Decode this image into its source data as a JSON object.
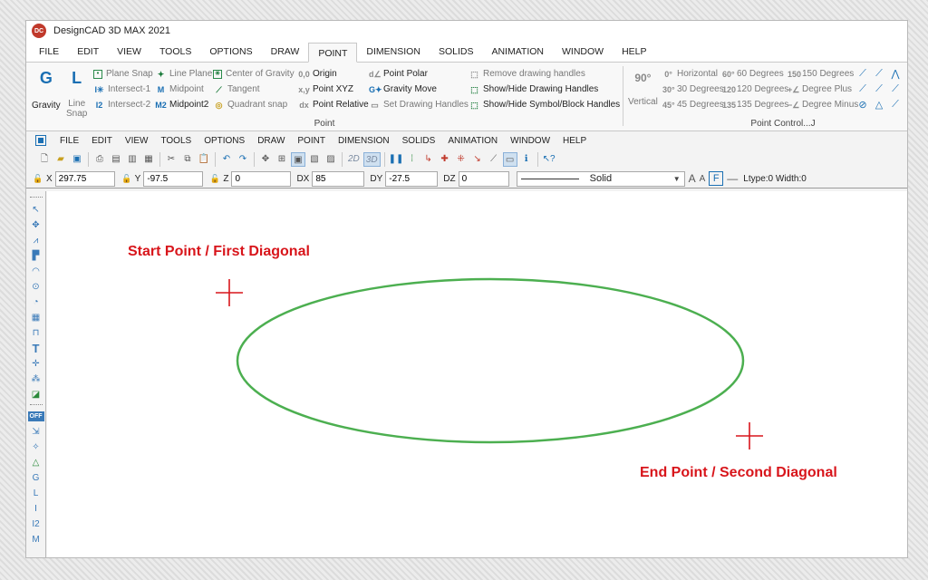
{
  "window": {
    "title": "DesignCAD 3D MAX 2021",
    "app_icon_text": "DC"
  },
  "ribbon_tabs": [
    "FILE",
    "EDIT",
    "VIEW",
    "TOOLS",
    "OPTIONS",
    "DRAW",
    "POINT",
    "DIMENSION",
    "SOLIDS",
    "ANIMATION",
    "WINDOW",
    "HELP"
  ],
  "active_tab": "POINT",
  "ribbon": {
    "gravity": {
      "label": "Gravity",
      "icon_text": "G"
    },
    "line_snap": {
      "label1": "Line",
      "label2": "Snap",
      "icon_text": "L"
    },
    "col1": [
      "Plane Snap",
      "Intersect-1",
      "Intersect-2"
    ],
    "col2": [
      "Line Plane",
      "Midpoint",
      "Midpoint2"
    ],
    "col3": [
      "Center of Gravity",
      "Tangent",
      "Quadrant snap"
    ],
    "col4": [
      "Origin",
      "Point XYZ",
      "Point Relative"
    ],
    "col5": [
      "Point Polar",
      "Gravity Move",
      "Set Drawing Handles"
    ],
    "col6": [
      "Remove drawing handles",
      "Show/Hide Drawing Handles",
      "Show/Hide Symbol/Block Handles"
    ],
    "point_group_label": "Point",
    "vertical": {
      "label": "Vertical",
      "icon_text": "90°"
    },
    "col7": [
      "Horizontal",
      "30 Degrees",
      "45 Degrees"
    ],
    "col8": [
      "60 Degrees",
      "120 Degrees",
      "135 Degrees"
    ],
    "col9": [
      "150 Degrees",
      "Degree Plus",
      "Degree Minus"
    ],
    "point_control_label": "Point Control...J"
  },
  "classic_menu": [
    "FILE",
    "EDIT",
    "VIEW",
    "TOOLS",
    "OPTIONS",
    "DRAW",
    "POINT",
    "DIMENSION",
    "SOLIDS",
    "ANIMATION",
    "WINDOW",
    "HELP"
  ],
  "toolbar": {
    "btn_2d": "2D",
    "btn_3d": "3D"
  },
  "coords": {
    "x_label": "X",
    "x": "297.75",
    "y_label": "Y",
    "y": "-97.5",
    "z_label": "Z",
    "z": "0",
    "dx_label": "DX",
    "dx": "85",
    "dy_label": "DY",
    "dy": "-27.5",
    "dz_label": "DZ",
    "dz": "0"
  },
  "linetype": {
    "name": "Solid",
    "info": "Ltype:0  Width:0"
  },
  "toolbox": {
    "off_label": "OFF"
  },
  "canvas": {
    "annotation_start": "Start Point / First Diagonal",
    "annotation_end": "End Point / Second Diagonal",
    "ellipse_color": "#4caf50",
    "marker_color": "#d8151b"
  }
}
